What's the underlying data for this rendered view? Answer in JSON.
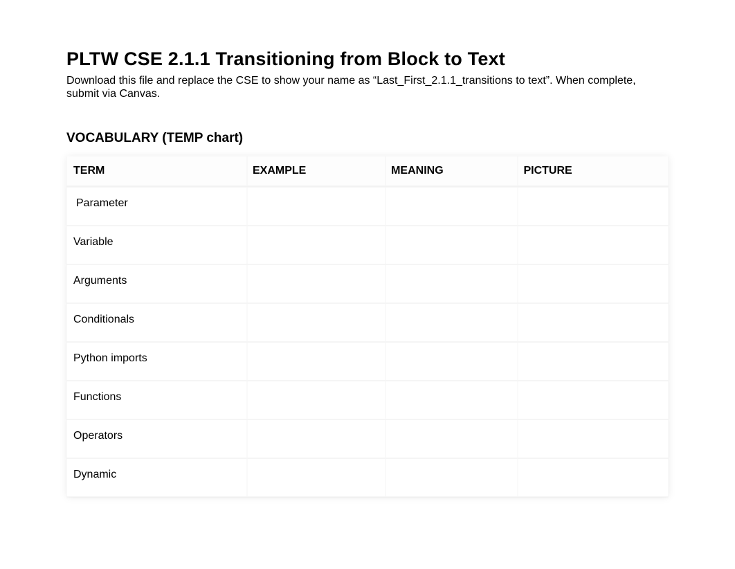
{
  "title": "PLTW CSE 2.1.1 Transitioning from Block to Text",
  "instructions": "Download this file and replace the CSE to show your name as “Last_First_2.1.1_transitions to text”. When complete, submit via Canvas.",
  "section_heading": "VOCABULARY (TEMP chart)",
  "table": {
    "headers": {
      "term": "TERM",
      "example": "EXAMPLE",
      "meaning": "MEANING",
      "picture": "PICTURE"
    },
    "rows": [
      {
        "term": "Parameter",
        "example": "",
        "meaning": "",
        "picture": ""
      },
      {
        "term": "Variable",
        "example": "",
        "meaning": "",
        "picture": ""
      },
      {
        "term": "Arguments",
        "example": "",
        "meaning": "",
        "picture": ""
      },
      {
        "term": "Conditionals",
        "example": "",
        "meaning": "",
        "picture": ""
      },
      {
        "term": "Python imports",
        "example": "",
        "meaning": "",
        "picture": ""
      },
      {
        "term": "Functions",
        "example": "",
        "meaning": "",
        "picture": ""
      },
      {
        "term": "Operators",
        "example": "",
        "meaning": "",
        "picture": ""
      },
      {
        "term": "Dynamic",
        "example": "",
        "meaning": "",
        "picture": ""
      }
    ]
  }
}
